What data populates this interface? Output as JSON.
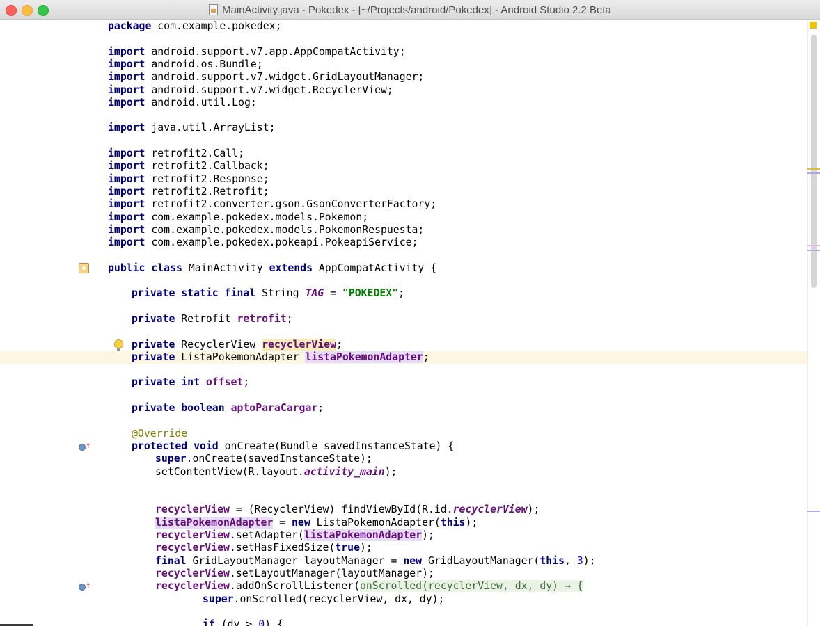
{
  "window": {
    "title": "MainActivity.java - Pokedex - [~/Projects/android/Pokedex] - Android Studio 2.2 Beta"
  },
  "editor": {
    "caret_line_index": 23,
    "lines": [
      {
        "indent": 0,
        "tokens": [
          {
            "t": "package",
            "c": "kw"
          },
          {
            "t": " com.example.pokedex;"
          }
        ]
      },
      {
        "indent": 0,
        "tokens": []
      },
      {
        "indent": 0,
        "tokens": [
          {
            "t": "import",
            "c": "kw"
          },
          {
            "t": " android.support.v7.app.AppCompatActivity;"
          }
        ]
      },
      {
        "indent": 0,
        "tokens": [
          {
            "t": "import",
            "c": "kw"
          },
          {
            "t": " android.os.Bundle;"
          }
        ]
      },
      {
        "indent": 0,
        "tokens": [
          {
            "t": "import",
            "c": "kw"
          },
          {
            "t": " android.support.v7.widget.GridLayoutManager;"
          }
        ]
      },
      {
        "indent": 0,
        "tokens": [
          {
            "t": "import",
            "c": "kw"
          },
          {
            "t": " android.support.v7.widget.RecyclerView;"
          }
        ]
      },
      {
        "indent": 0,
        "tokens": [
          {
            "t": "import",
            "c": "kw"
          },
          {
            "t": " android.util.Log;"
          }
        ]
      },
      {
        "indent": 0,
        "tokens": []
      },
      {
        "indent": 0,
        "tokens": [
          {
            "t": "import",
            "c": "kw"
          },
          {
            "t": " java.util.ArrayList;"
          }
        ]
      },
      {
        "indent": 0,
        "tokens": []
      },
      {
        "indent": 0,
        "tokens": [
          {
            "t": "import",
            "c": "kw"
          },
          {
            "t": " retrofit2.Call;"
          }
        ]
      },
      {
        "indent": 0,
        "tokens": [
          {
            "t": "import",
            "c": "kw"
          },
          {
            "t": " retrofit2.Callback;"
          }
        ]
      },
      {
        "indent": 0,
        "tokens": [
          {
            "t": "import",
            "c": "kw"
          },
          {
            "t": " retrofit2.Response;"
          }
        ]
      },
      {
        "indent": 0,
        "tokens": [
          {
            "t": "import",
            "c": "kw"
          },
          {
            "t": " retrofit2.Retrofit;"
          }
        ]
      },
      {
        "indent": 0,
        "tokens": [
          {
            "t": "import",
            "c": "kw"
          },
          {
            "t": " retrofit2.converter.gson.GsonConverterFactory;"
          }
        ]
      },
      {
        "indent": 0,
        "tokens": [
          {
            "t": "import",
            "c": "kw"
          },
          {
            "t": " com.example.pokedex.models.Pokemon;"
          }
        ]
      },
      {
        "indent": 0,
        "tokens": [
          {
            "t": "import",
            "c": "kw"
          },
          {
            "t": " com.example.pokedex.models.PokemonRespuesta;"
          }
        ]
      },
      {
        "indent": 0,
        "tokens": [
          {
            "t": "import",
            "c": "kw"
          },
          {
            "t": " com.example.pokedex.pokeapi.PokeapiService;"
          }
        ]
      },
      {
        "indent": 0,
        "tokens": []
      },
      {
        "indent": 0,
        "tokens": [
          {
            "t": "public class",
            "c": "kw"
          },
          {
            "t": " MainActivity "
          },
          {
            "t": "extends",
            "c": "kw"
          },
          {
            "t": " AppCompatActivity {"
          }
        ]
      },
      {
        "indent": 0,
        "tokens": []
      },
      {
        "indent": 1,
        "tokens": [
          {
            "t": "private static final",
            "c": "kw"
          },
          {
            "t": " String "
          },
          {
            "t": "TAG",
            "c": "cst"
          },
          {
            "t": " = "
          },
          {
            "t": "\"POKEDEX\"",
            "c": "str"
          },
          {
            "t": ";"
          }
        ]
      },
      {
        "indent": 0,
        "tokens": []
      },
      {
        "indent": 1,
        "tokens": [
          {
            "t": "private",
            "c": "kw"
          },
          {
            "t": " Retrofit "
          },
          {
            "t": "retrofit",
            "c": "fld"
          },
          {
            "t": ";"
          }
        ]
      },
      {
        "indent": 0,
        "tokens": []
      },
      {
        "indent": 1,
        "tokens": [
          {
            "t": "private",
            "c": "kw"
          },
          {
            "t": " RecyclerView "
          },
          {
            "t": "recyclerView",
            "c": "fld hl-read"
          },
          {
            "t": ";"
          }
        ]
      },
      {
        "indent": 1,
        "tokens": [
          {
            "t": "private",
            "c": "kw"
          },
          {
            "t": " ListaPokemonAdapter "
          },
          {
            "t": "listaPokemonAdapter",
            "c": "fld hl-write"
          },
          {
            "t": ";"
          }
        ]
      },
      {
        "indent": 0,
        "tokens": []
      },
      {
        "indent": 1,
        "tokens": [
          {
            "t": "private int",
            "c": "kw"
          },
          {
            "t": " "
          },
          {
            "t": "offset",
            "c": "fld"
          },
          {
            "t": ";"
          }
        ]
      },
      {
        "indent": 0,
        "tokens": []
      },
      {
        "indent": 1,
        "tokens": [
          {
            "t": "private boolean",
            "c": "kw"
          },
          {
            "t": " "
          },
          {
            "t": "aptoParaCargar",
            "c": "fld"
          },
          {
            "t": ";"
          }
        ]
      },
      {
        "indent": 0,
        "tokens": []
      },
      {
        "indent": 1,
        "tokens": [
          {
            "t": "@Override",
            "c": "ann"
          }
        ]
      },
      {
        "indent": 1,
        "tokens": [
          {
            "t": "protected void",
            "c": "kw"
          },
          {
            "t": " onCreate(Bundle savedInstanceState) {"
          }
        ]
      },
      {
        "indent": 2,
        "tokens": [
          {
            "t": "super",
            "c": "kw"
          },
          {
            "t": ".onCreate(savedInstanceState);"
          }
        ]
      },
      {
        "indent": 2,
        "tokens": [
          {
            "t": "setContentView(R.layout."
          },
          {
            "t": "activity_main",
            "c": "cst"
          },
          {
            "t": ");"
          }
        ]
      },
      {
        "indent": 0,
        "tokens": []
      },
      {
        "indent": 0,
        "tokens": []
      },
      {
        "indent": 2,
        "tokens": [
          {
            "t": "recyclerView",
            "c": "fld"
          },
          {
            "t": " = (RecyclerView) findViewById(R.id."
          },
          {
            "t": "recyclerView",
            "c": "cst"
          },
          {
            "t": ");"
          }
        ]
      },
      {
        "indent": 2,
        "tokens": [
          {
            "t": "listaPokemonAdapter",
            "c": "fld hl-write"
          },
          {
            "t": " = "
          },
          {
            "t": "new",
            "c": "kw"
          },
          {
            "t": " ListaPokemonAdapter("
          },
          {
            "t": "this",
            "c": "kw"
          },
          {
            "t": ");"
          }
        ]
      },
      {
        "indent": 2,
        "tokens": [
          {
            "t": "recyclerView",
            "c": "fld"
          },
          {
            "t": ".setAdapter("
          },
          {
            "t": "listaPokemonAdapter",
            "c": "fld hl-write"
          },
          {
            "t": ");"
          }
        ]
      },
      {
        "indent": 2,
        "tokens": [
          {
            "t": "recyclerView",
            "c": "fld"
          },
          {
            "t": ".setHasFixedSize("
          },
          {
            "t": "true",
            "c": "kw"
          },
          {
            "t": ");"
          }
        ]
      },
      {
        "indent": 2,
        "tokens": [
          {
            "t": "final",
            "c": "kw"
          },
          {
            "t": " GridLayoutManager layoutManager = "
          },
          {
            "t": "new",
            "c": "kw"
          },
          {
            "t": " GridLayoutManager("
          },
          {
            "t": "this",
            "c": "kw"
          },
          {
            "t": ", "
          },
          {
            "t": "3",
            "c": "num"
          },
          {
            "t": ");"
          }
        ]
      },
      {
        "indent": 2,
        "tokens": [
          {
            "t": "recyclerView",
            "c": "fld"
          },
          {
            "t": ".setLayoutManager(layoutManager);"
          }
        ]
      },
      {
        "indent": 2,
        "tokens": [
          {
            "t": "recyclerView",
            "c": "fld"
          },
          {
            "t": ".addOnScrollListener("
          },
          {
            "t": "onScrolled(recyclerView, dx, dy) → {",
            "c": "lambda"
          }
        ]
      },
      {
        "indent": 4,
        "tokens": [
          {
            "t": "super",
            "c": "kw"
          },
          {
            "t": ".onScrolled(recyclerView, dx, dy);"
          }
        ]
      },
      {
        "indent": 0,
        "tokens": []
      },
      {
        "indent": 4,
        "tokens": [
          {
            "t": "if",
            "c": "kw"
          },
          {
            "t": " (dy > "
          },
          {
            "t": "0",
            "c": "num"
          },
          {
            "t": ") {"
          }
        ]
      }
    ]
  },
  "gutter": [
    {
      "line": 19,
      "icon": "class-icon"
    },
    {
      "line": 25,
      "icon": "bulb-icon"
    },
    {
      "line": 33,
      "icon": "override-icon"
    },
    {
      "line": 44,
      "icon": "override-icon"
    }
  ],
  "scrollbar": {
    "markers": [
      {
        "kind": "yellow",
        "ratio": 0.244
      },
      {
        "kind": "purple",
        "ratio": 0.252
      },
      {
        "kind": "pink",
        "ratio": 0.371
      },
      {
        "kind": "purple",
        "ratio": 0.379
      },
      {
        "kind": "purple",
        "ratio": 0.809
      }
    ]
  },
  "colors": {
    "keyword": "#000080",
    "field": "#660e7a",
    "string": "#008000",
    "annotation": "#808000",
    "number": "#0000ff",
    "caret_row": "#fdf6e0"
  }
}
